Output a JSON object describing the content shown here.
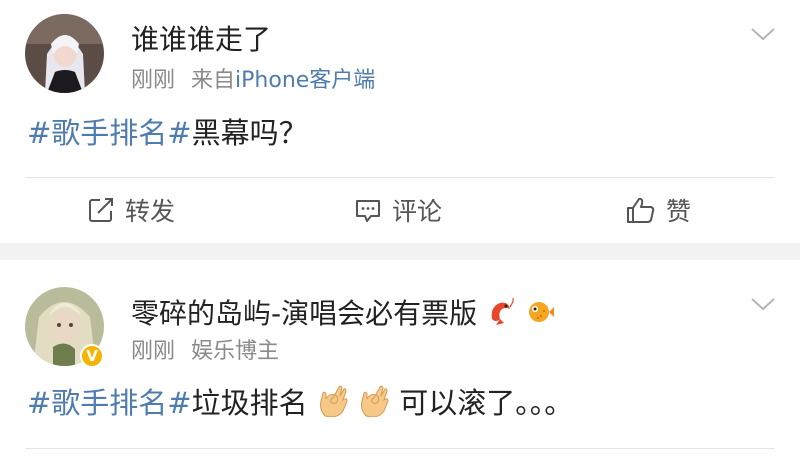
{
  "posts": [
    {
      "username": "谁谁谁走了",
      "time": "刚刚",
      "source_prefix": "来自",
      "source_app": "iPhone客户端",
      "content": {
        "hashtag": "#歌手排名#",
        "text": "黑幕吗？"
      },
      "actions": {
        "repost": "转发",
        "comment": "评论",
        "like": "赞"
      }
    },
    {
      "username": "零碎的岛屿-演唱会必有票版",
      "username_emoji": [
        "shrimp-icon",
        "pufferfish-icon"
      ],
      "verified_badge": "V",
      "time": "刚刚",
      "profile_tag": "娱乐博主",
      "content": {
        "hashtag": "#歌手排名#",
        "text_before": "垃圾排名",
        "emoji": [
          "ok-hand-icon",
          "ok-hand-icon"
        ],
        "text_after": "可以滚了。。。"
      }
    }
  ],
  "colors": {
    "link": "#4f7cae",
    "meta": "#8a8a8a",
    "separator": "#f2f2f2",
    "badge": "#f5b400"
  }
}
